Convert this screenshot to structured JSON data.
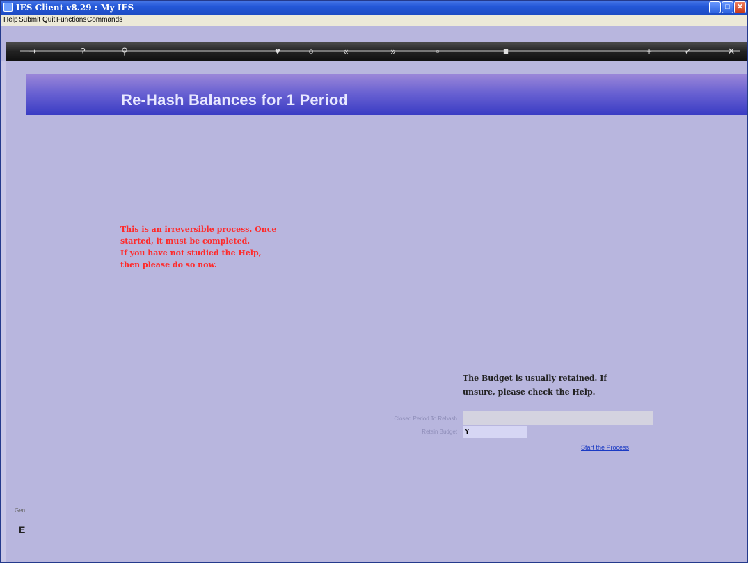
{
  "window": {
    "title": "IES Client v8.29 : My IES"
  },
  "menubar": {
    "items": [
      "Help",
      "Submit",
      "Quit",
      "Functions",
      "Commands"
    ]
  },
  "toolbar": {
    "icons": [
      "arrow-right-icon",
      "help-icon",
      "search-icon",
      "heart-icon",
      "circle-icon",
      "rewind-icon",
      "fast-forward-icon",
      "page-icon",
      "square-icon",
      "add-icon",
      "check-icon",
      "close-icon"
    ]
  },
  "header": {
    "title": "Re-Hash Balances for 1 Period"
  },
  "warning": {
    "lines": [
      "This is an irreversible process. Once",
      "started, it must be completed.",
      "If you have not studied the Help,",
      "then please do so now."
    ]
  },
  "note": {
    "lines": [
      "The Budget is usually retained. If",
      "unsure, please check the Help."
    ]
  },
  "form": {
    "closed_period_label": "Closed Period To Rehash",
    "closed_period_value": "",
    "retain_budget_label": "Retain Budget",
    "retain_budget_value": "Y"
  },
  "actions": {
    "start_link": "Start the Process"
  },
  "side": {
    "a": "Gen",
    "b": "E"
  },
  "colors": {
    "header_top": "#9a86d8",
    "header_bottom": "#3a3cc4",
    "page_bg": "#b8b6de",
    "warning": "#ff2a2a",
    "link": "#1a3ac4"
  }
}
